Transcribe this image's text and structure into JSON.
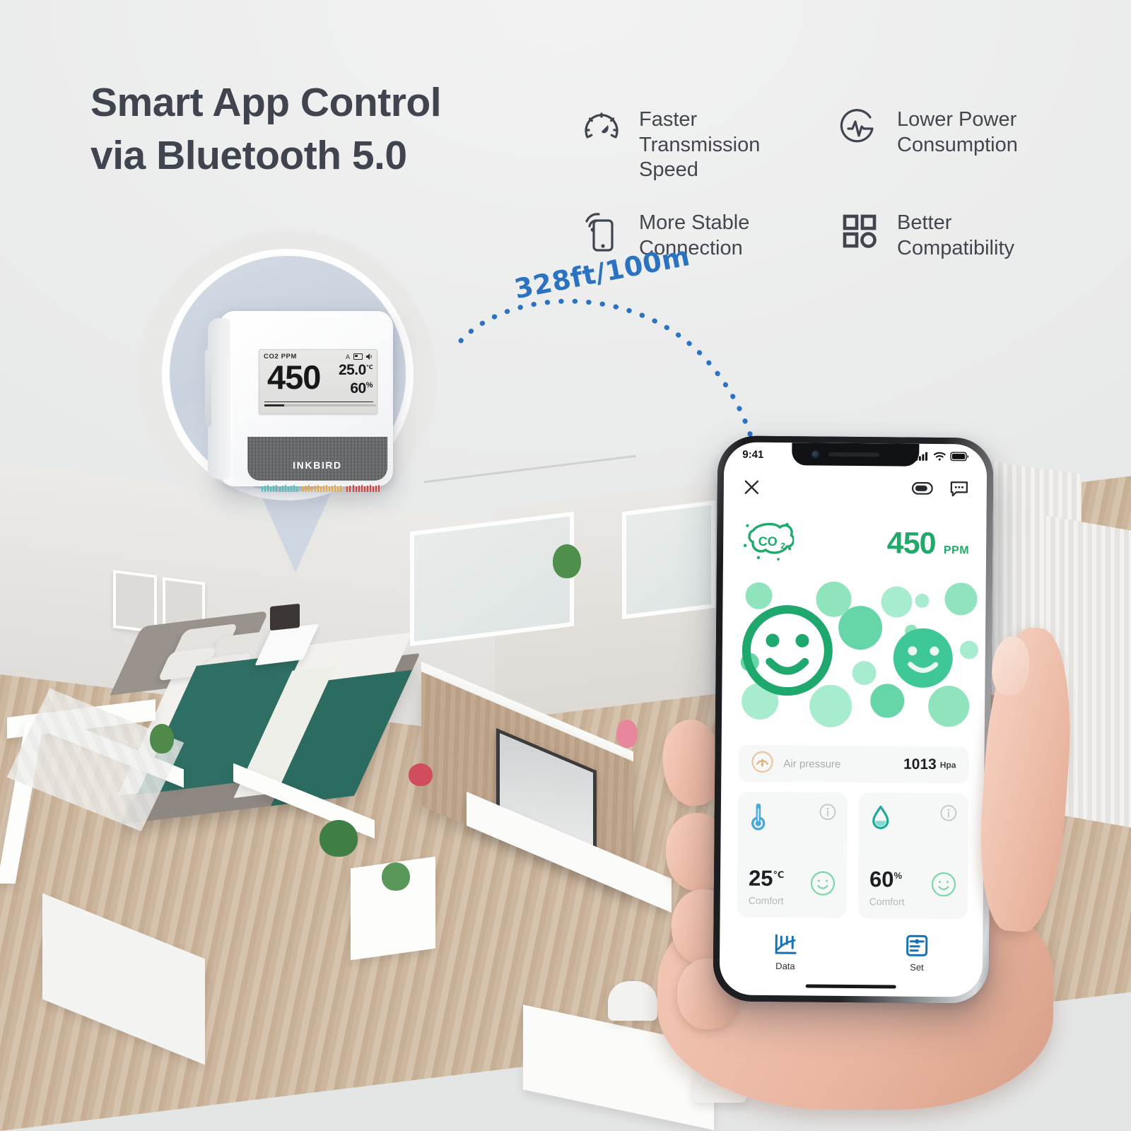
{
  "headline": {
    "line1": "Smart App Control",
    "line2": "via Bluetooth 5.0"
  },
  "features": [
    {
      "icon": "speedometer-icon",
      "label": "Faster\nTransmission\nSpeed"
    },
    {
      "icon": "pulse-circle-icon",
      "label": "Lower Power\nConsumption"
    },
    {
      "icon": "phone-signal-icon",
      "label": "More Stable\nConnection"
    },
    {
      "icon": "compatibility-grid-icon",
      "label": "Better\nCompatibility"
    }
  ],
  "range": {
    "label": "328ft/100m",
    "color": "#2c72c2"
  },
  "device": {
    "brand": "INKBIRD",
    "lcd": {
      "label": "CO2  PPM",
      "co2": "450",
      "temperature": "25.0",
      "temperature_unit": "℃",
      "humidity": "60",
      "humidity_unit": "%",
      "indicator_auto": "A"
    },
    "bar_colors": [
      "#4fc3bd",
      "#f0a93c",
      "#e0413f"
    ]
  },
  "phone": {
    "status": {
      "time": "9:41",
      "signal": "cellular-icon",
      "wifi": "wifi-icon",
      "battery": "battery-icon"
    },
    "appbar": {
      "close": "close-icon",
      "battery_pill": "device-battery-icon",
      "message": "message-icon"
    },
    "co2": {
      "badge": "co2-badge-icon",
      "value": "450",
      "unit": "PPM",
      "color": "#1fa96b"
    },
    "pressure": {
      "icon": "pressure-gauge-icon",
      "label": "Air pressure",
      "value": "1013",
      "unit": "Hpa"
    },
    "cards": [
      {
        "icon": "thermometer-icon",
        "info": "info-icon",
        "value": "25",
        "unit": "℃",
        "status": "Comfort",
        "face": "smiley-icon",
        "accent": "#49a8dd"
      },
      {
        "icon": "humidity-drop-icon",
        "info": "info-icon",
        "value": "60",
        "unit": "%",
        "status": "Comfort",
        "face": "smiley-icon",
        "accent": "#22a896"
      }
    ],
    "tabs": [
      {
        "icon": "chart-icon",
        "label": "Data"
      },
      {
        "icon": "settings-panel-icon",
        "label": "Set"
      }
    ],
    "tab_color": "#1472b8"
  }
}
